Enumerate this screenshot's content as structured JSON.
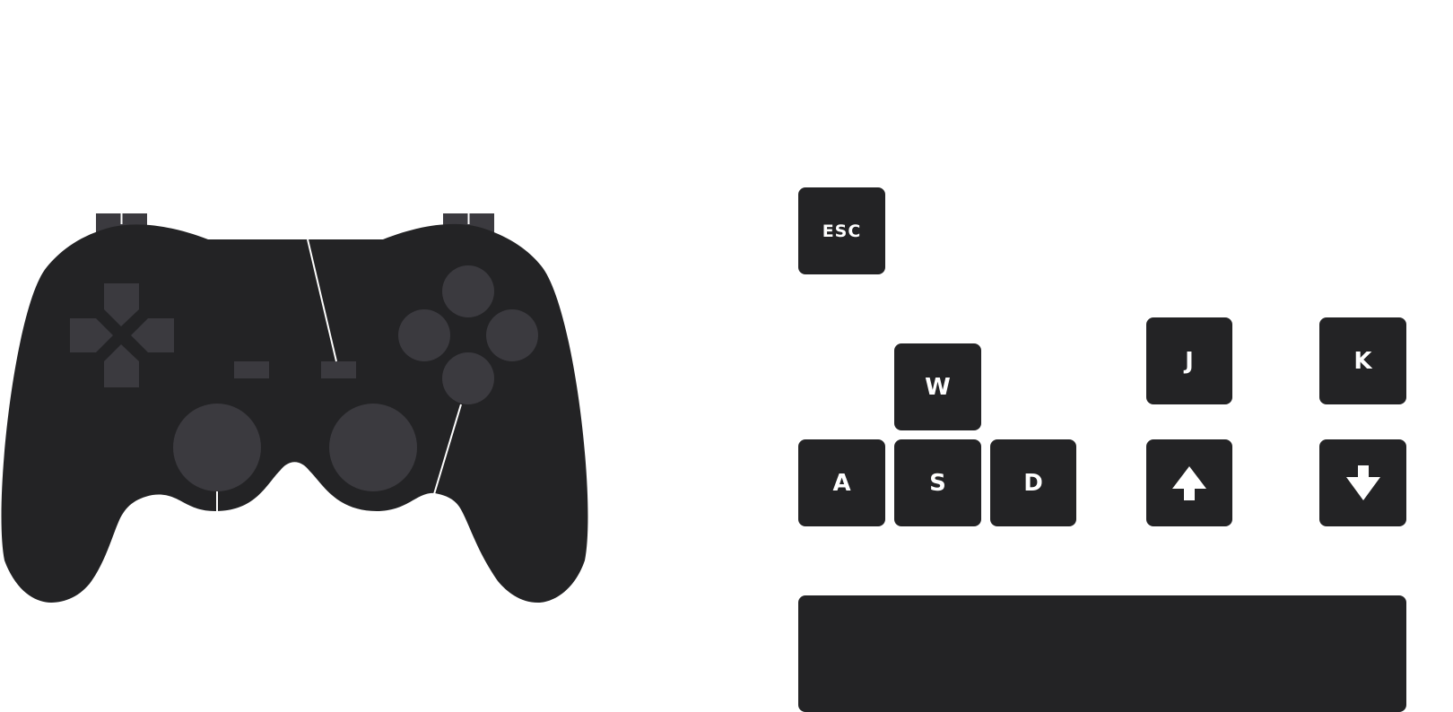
{
  "colors": {
    "body": "#232325",
    "button": "#3b3a3f",
    "line": "#ffffff",
    "key_text": "#ffffff"
  },
  "controller": {
    "icons": [
      "shoulder-left-icon",
      "shoulder-right-icon",
      "dpad-icon",
      "select-icon",
      "start-icon",
      "face-buttons-icon",
      "left-stick-icon",
      "right-stick-icon"
    ]
  },
  "keyboard": {
    "esc": "ESC",
    "w": "W",
    "a": "A",
    "s": "S",
    "d": "D",
    "j": "J",
    "k": "K",
    "up_icon": "arrow-up-icon",
    "down_icon": "arrow-down-icon",
    "space_icon": "spacebar"
  }
}
